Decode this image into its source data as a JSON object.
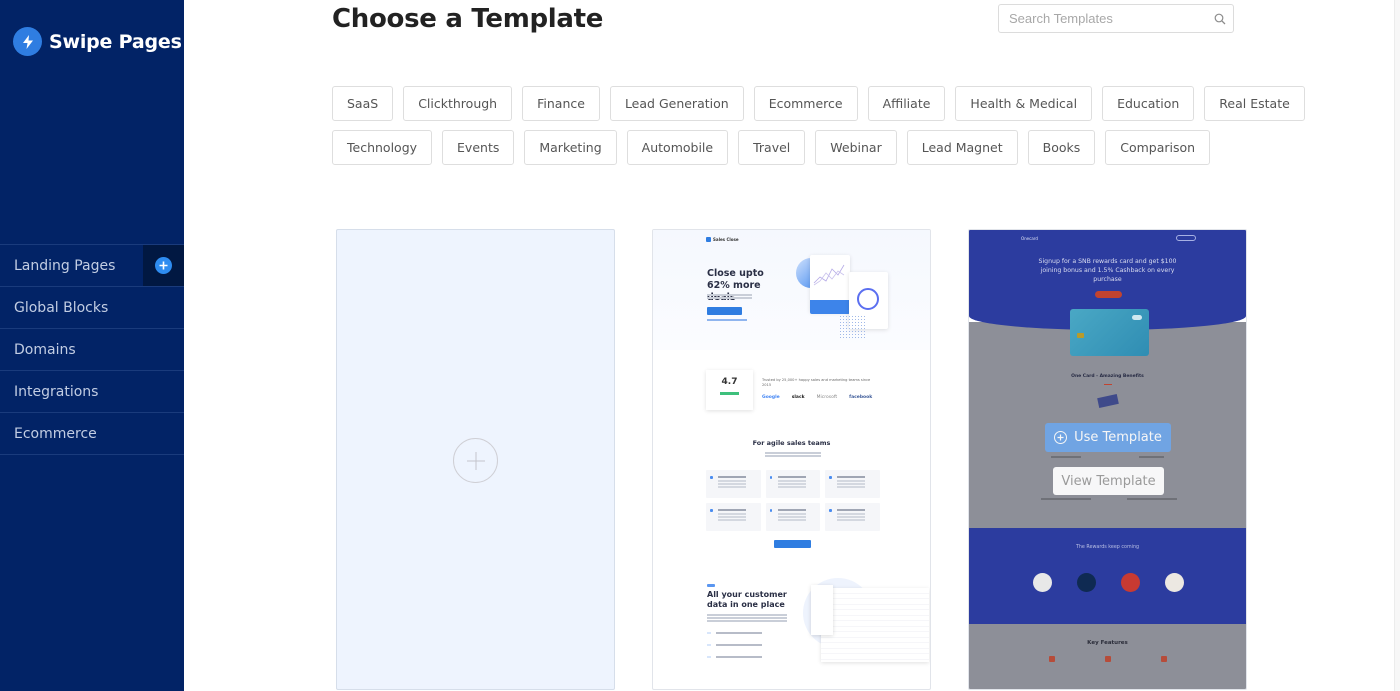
{
  "brand": {
    "name": "Swipe Pages",
    "icon": "bolt-icon",
    "accent": "#2f7de1"
  },
  "sidebar": {
    "background": "#022366",
    "items": [
      {
        "label": "Landing Pages",
        "has_add": true
      },
      {
        "label": "Global Blocks"
      },
      {
        "label": "Domains"
      },
      {
        "label": "Integrations"
      },
      {
        "label": "Ecommerce"
      }
    ]
  },
  "header": {
    "title": "Choose a Template",
    "search": {
      "placeholder": "Search Templates",
      "value": "",
      "icon": "search-icon"
    }
  },
  "categories": {
    "row1": [
      "SaaS",
      "Clickthrough",
      "Finance",
      "Lead Generation",
      "Ecommerce",
      "Affiliate",
      "Health & Medical",
      "Education",
      "Real Estate"
    ],
    "row2": [
      "Technology",
      "Events",
      "Marketing",
      "Automobile",
      "Travel",
      "Webinar",
      "Lead Magnet",
      "Books",
      "Comparison"
    ]
  },
  "templates": {
    "blank": {
      "icon": "plus-circle-icon"
    },
    "sales": {
      "logo": "Sales Close",
      "hero_title": "Close upto 62% more deals",
      "rating": "4.7",
      "trust_text": "Trusted by 25,000+ happy sales and marketing teams since 2015",
      "brands": [
        "Google",
        "slack",
        "Microsoft",
        "facebook"
      ],
      "section_title": "For agile sales teams",
      "section2_title": "All your customer data in one place"
    },
    "rewards": {
      "logo": "Onecard",
      "hero_title": "Signup for a SNB rewards card and get $100 joining bonus and 1.5% Cashback on every purchase",
      "benefits_title": "One Card - Amazing Benefits",
      "rewards_title": "The Rewards keep coming",
      "features_title": "Key Features",
      "use_label": "Use Template",
      "view_label": "View Template"
    }
  }
}
